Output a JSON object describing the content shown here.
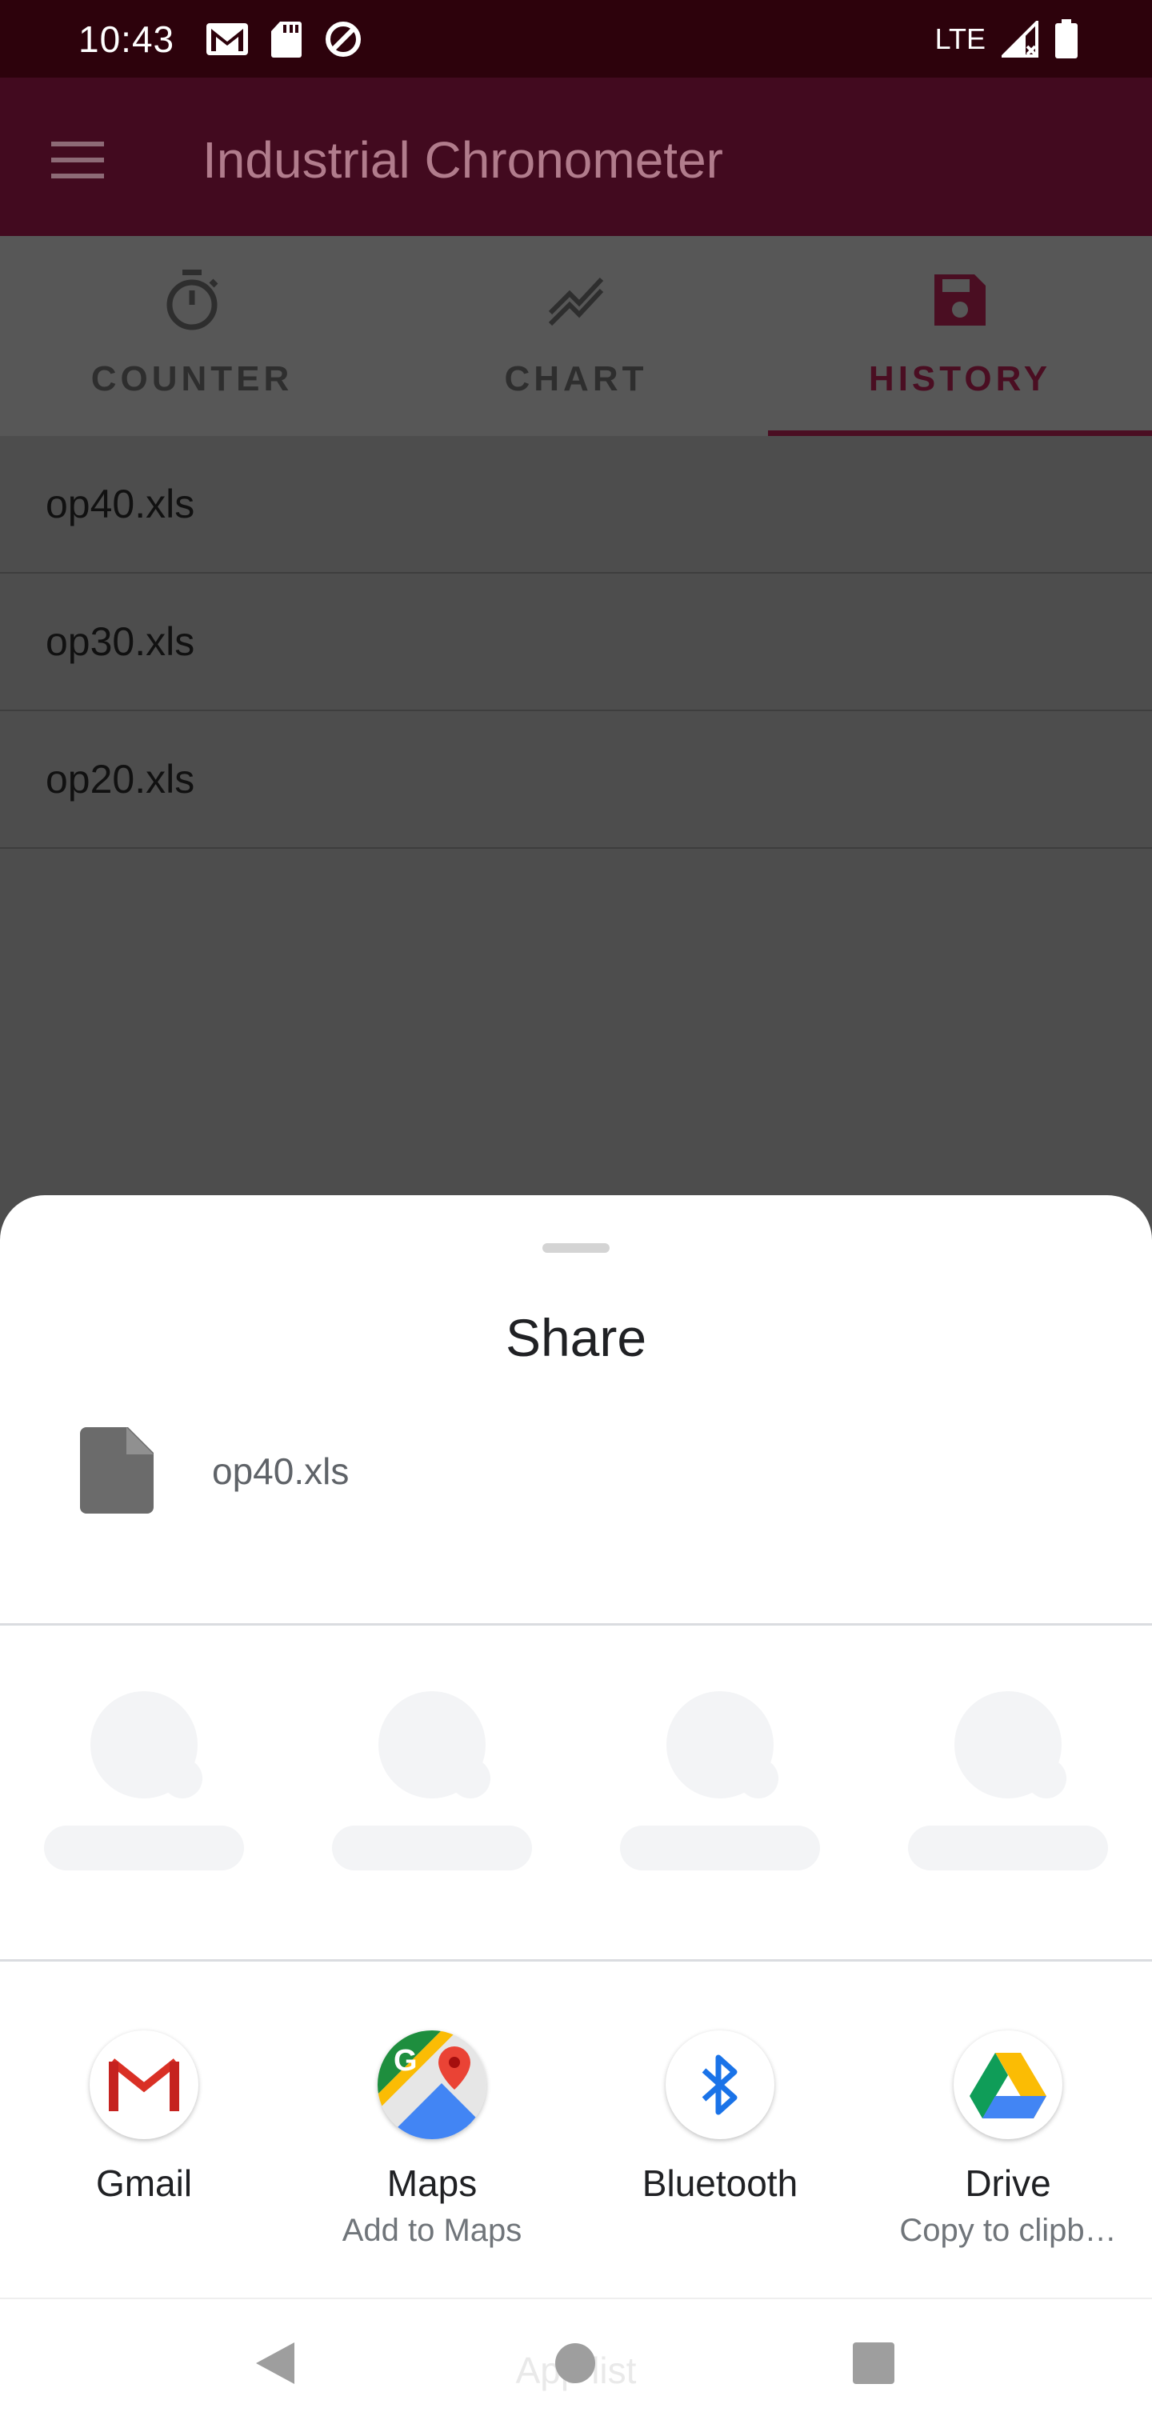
{
  "status_bar": {
    "time": "10:43",
    "network": "LTE",
    "left_icons": [
      "gmail-notification-icon",
      "sd-card-icon",
      "data-saver-icon"
    ],
    "right_icons": [
      "signal-icon",
      "battery-icon"
    ]
  },
  "app_bar": {
    "title": "Industrial Chronometer",
    "menu_icon": "menu-icon"
  },
  "tabs": [
    {
      "label": "COUNTER",
      "icon": "timer-icon",
      "active": false
    },
    {
      "label": "CHART",
      "icon": "chart-icon",
      "active": false
    },
    {
      "label": "HISTORY",
      "icon": "save-icon",
      "active": true
    }
  ],
  "files": [
    "op40.xls",
    "op30.xls",
    "op20.xls"
  ],
  "share_sheet": {
    "title": "Share",
    "file_name": "op40.xls",
    "apps": [
      {
        "name": "Gmail",
        "sub": ""
      },
      {
        "name": "Maps",
        "sub": "Add to Maps"
      },
      {
        "name": "Bluetooth",
        "sub": ""
      },
      {
        "name": "Drive",
        "sub": "Copy to clipb…"
      }
    ],
    "peek_text": "App list"
  },
  "colors": {
    "status_bar": "#2d020c",
    "app_bar": "#420a1f",
    "accent": "#4a0e22",
    "scrim_background": "#4d4d4d"
  }
}
